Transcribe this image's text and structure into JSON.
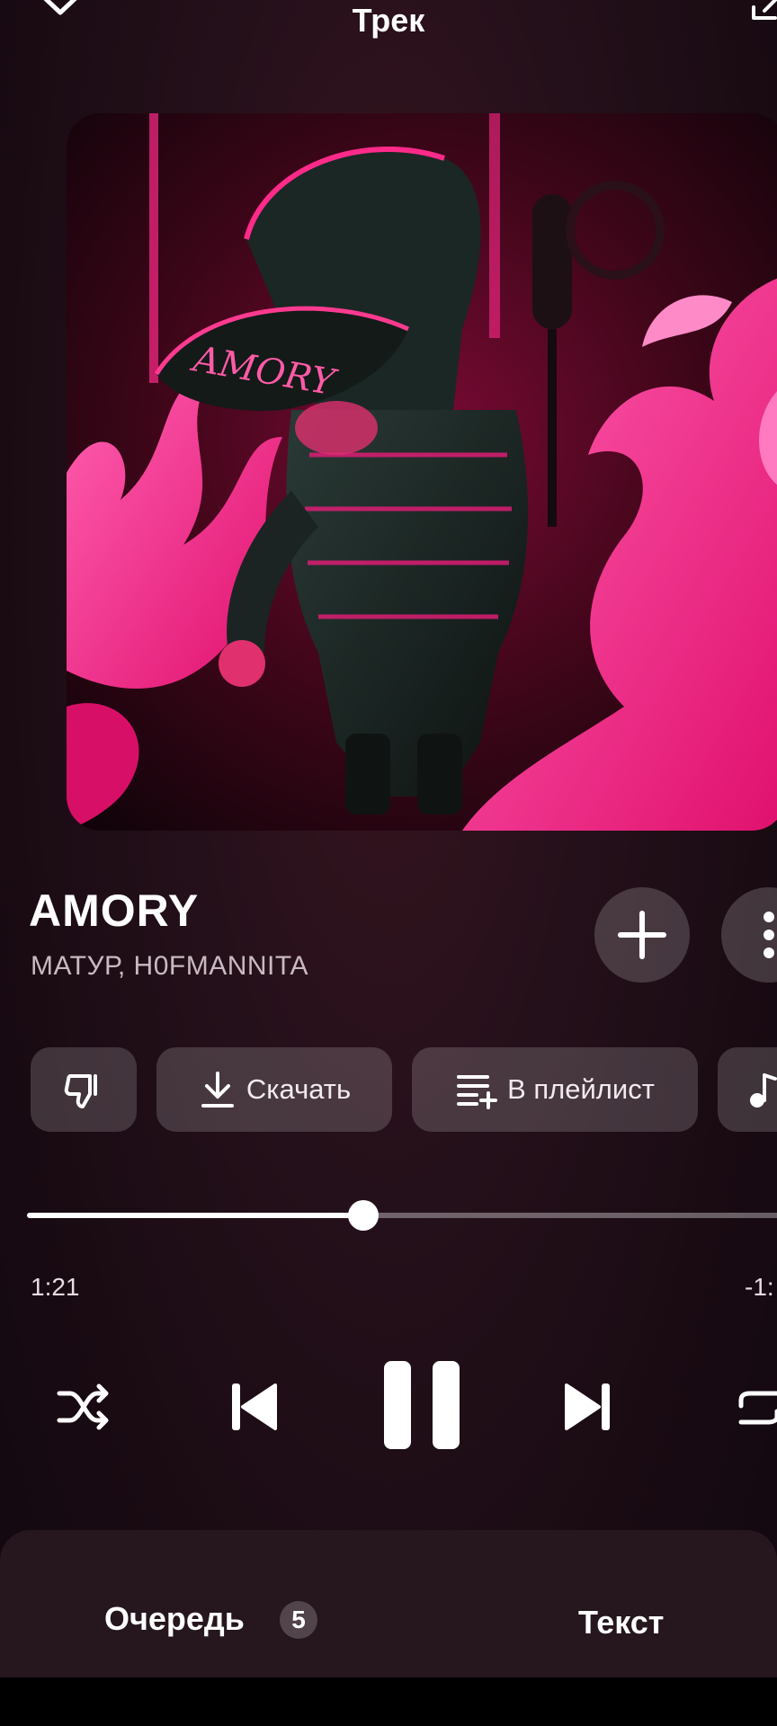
{
  "header": {
    "title": "Трек",
    "collapse_icon": "chevron-down-icon",
    "share_icon": "share-icon"
  },
  "cover": {
    "cap_text": "AMORY",
    "accent_color": "#ff1f8a"
  },
  "track": {
    "title": "AMORY",
    "artists": "МАТУР, H0FMANNITA"
  },
  "track_actions": {
    "add_icon": "plus-icon",
    "more_icon": "more-vertical-icon"
  },
  "action_chips": {
    "dislike_icon": "thumbs-down-icon",
    "download_label": "Скачать",
    "download_icon": "download-icon",
    "playlist_label": "В плейлист",
    "playlist_icon": "add-to-playlist-icon",
    "extra_icon": "music-note-icon"
  },
  "playback": {
    "elapsed": "1:21",
    "remaining": "-1:",
    "progress_fraction": 0.435
  },
  "controls": {
    "shuffle_icon": "shuffle-icon",
    "previous_icon": "skip-previous-icon",
    "play_pause_icon": "pause-icon",
    "next_icon": "skip-next-icon",
    "repeat_icon": "repeat-icon"
  },
  "bottom_tabs": {
    "queue_label": "Очередь",
    "queue_count": "5",
    "lyrics_label": "Текст"
  }
}
